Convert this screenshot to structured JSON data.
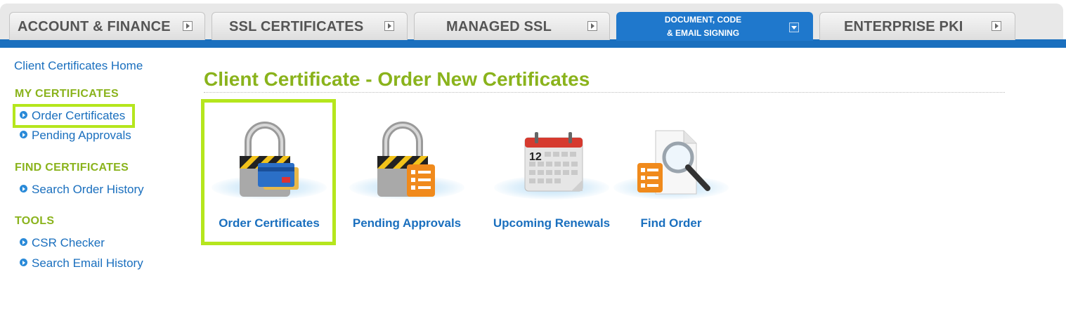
{
  "nav": {
    "tabs": [
      {
        "label": "ACCOUNT & FINANCE"
      },
      {
        "label": "SSL CERTIFICATES"
      },
      {
        "label": "MANAGED SSL"
      },
      {
        "label_line1": "DOCUMENT, CODE",
        "label_line2": "& EMAIL SIGNING",
        "active": true
      },
      {
        "label": "ENTERPRISE PKI"
      }
    ]
  },
  "sidebar": {
    "home": "Client Certificates Home",
    "sections": [
      {
        "heading": "MY CERTIFICATES",
        "items": [
          "Order Certificates",
          "Pending Approvals"
        ]
      },
      {
        "heading": "FIND CERTIFICATES",
        "items": [
          "Search Order History"
        ]
      },
      {
        "heading": "TOOLS",
        "items": [
          "CSR Checker",
          "Search Email History"
        ]
      }
    ]
  },
  "main": {
    "title": "Client Certificate - Order New Certificates",
    "tiles": [
      {
        "label": "Order Certificates",
        "icon": "padlock-credit-card-icon"
      },
      {
        "label": "Pending Approvals",
        "icon": "padlock-checklist-icon"
      },
      {
        "label": "Upcoming Renewals",
        "icon": "calendar-icon",
        "calendar_day": "12"
      },
      {
        "label": "Find Order",
        "icon": "magnifier-document-icon"
      }
    ]
  },
  "colors": {
    "accent_green": "#8ab31c",
    "link_blue": "#1a6fbe",
    "nav_blue": "#1f78cc",
    "highlight": "#b5e61d"
  }
}
